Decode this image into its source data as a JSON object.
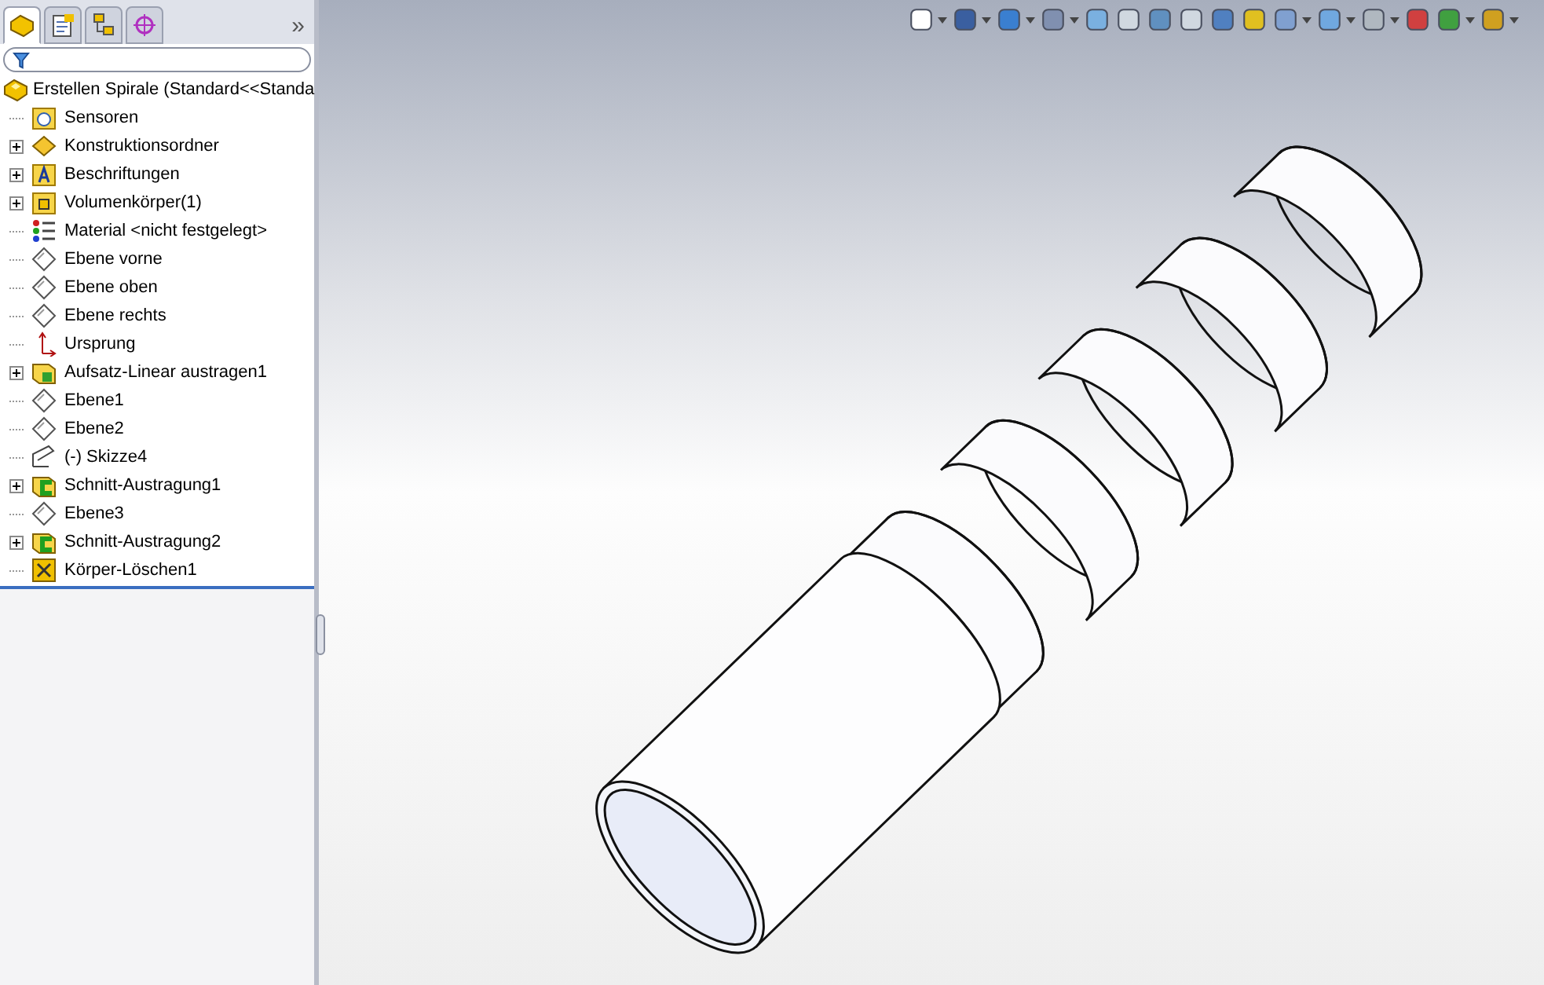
{
  "panel_tabs": [
    {
      "kind": "feature",
      "selected": true
    },
    {
      "kind": "property",
      "selected": false
    },
    {
      "kind": "config",
      "selected": false
    },
    {
      "kind": "dim",
      "selected": false
    }
  ],
  "panel_more": "»",
  "tree": {
    "root": {
      "kind": "part",
      "label": "Erstellen Spirale  (Standard<<Standa"
    },
    "items": [
      {
        "kind": "sensor",
        "label": "Sensoren",
        "expandable": false
      },
      {
        "kind": "folder-diamond",
        "label": "Konstruktionsordner",
        "expandable": true
      },
      {
        "kind": "annotation",
        "label": "Beschriftungen",
        "expandable": true
      },
      {
        "kind": "solid",
        "label": "Volumenkörper(1)",
        "expandable": true
      },
      {
        "kind": "material",
        "label": "Material <nicht festgelegt>",
        "expandable": false
      },
      {
        "kind": "plane",
        "label": "Ebene vorne",
        "expandable": false
      },
      {
        "kind": "plane",
        "label": "Ebene oben",
        "expandable": false
      },
      {
        "kind": "plane",
        "label": "Ebene rechts",
        "expandable": false
      },
      {
        "kind": "origin",
        "label": "Ursprung",
        "expandable": false
      },
      {
        "kind": "loft",
        "label": "Aufsatz-Linear austragen1",
        "expandable": true
      },
      {
        "kind": "plane",
        "label": "Ebene1",
        "expandable": false
      },
      {
        "kind": "plane",
        "label": "Ebene2",
        "expandable": false
      },
      {
        "kind": "sketch",
        "label": "(-) Skizze4",
        "expandable": false
      },
      {
        "kind": "cut",
        "label": "Schnitt-Austragung1",
        "expandable": true
      },
      {
        "kind": "plane",
        "label": "Ebene3",
        "expandable": false
      },
      {
        "kind": "cut",
        "label": "Schnitt-Austragung2",
        "expandable": true
      },
      {
        "kind": "delete",
        "label": "Körper-Löschen1",
        "expandable": false
      }
    ]
  }
}
